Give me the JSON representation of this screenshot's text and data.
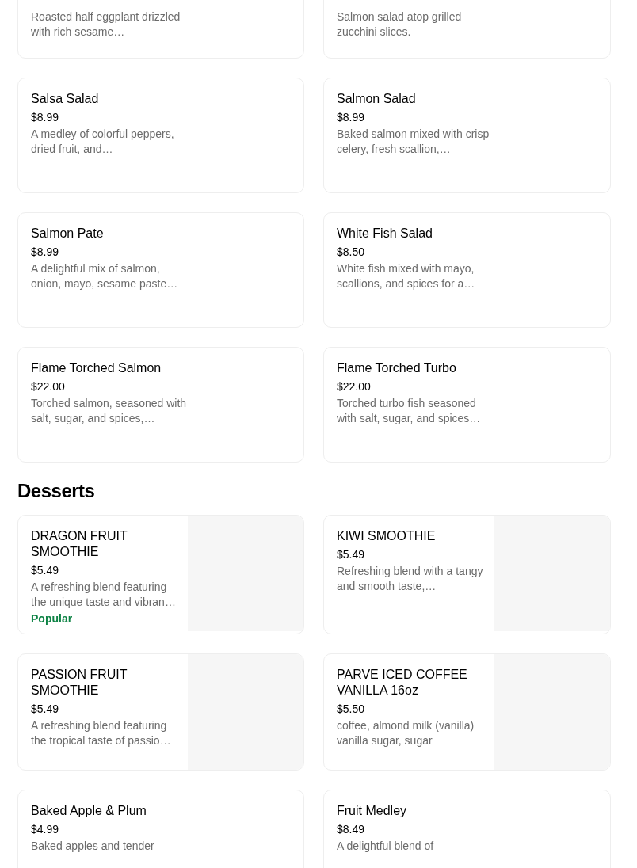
{
  "sections": [
    {
      "items": [
        {
          "description": "Roasted half eggplant drizzled with rich sesame…",
          "has_image": false
        },
        {
          "description": "Salmon salad atop grilled zucchini slices.",
          "has_image": false
        },
        {
          "name": "Salsa Salad",
          "price": "$8.99",
          "description": "A medley of colorful peppers, dried fruit, and…",
          "has_image": false
        },
        {
          "name": "Salmon Salad",
          "price": "$8.99",
          "description": "Baked salmon mixed with crisp celery, fresh scallion,…",
          "has_image": false
        },
        {
          "name": "Salmon Pate",
          "price": "$8.99",
          "description": "A delightful mix of salmon, onion, mayo, sesame paste…",
          "has_image": false
        },
        {
          "name": "White Fish Salad",
          "price": "$8.50",
          "description": "White fish mixed with mayo, scallions, and spices for a…",
          "has_image": false
        },
        {
          "name": "Flame Torched Salmon",
          "price": "$22.00",
          "description": "Torched salmon, seasoned with salt, sugar, and spices,…",
          "has_image": false
        },
        {
          "name": "Flame Torched Turbo",
          "price": "$22.00",
          "description": "Torched turbo fish seasoned with salt, sugar, and spices…",
          "has_image": false
        }
      ]
    },
    {
      "title": "Desserts",
      "items": [
        {
          "name": "DRAGON FRUIT SMOOTHIE",
          "price": "$5.49",
          "description": "A refreshing blend featuring the unique taste and vibran…",
          "badge": "Popular",
          "has_image": true
        },
        {
          "name": "KIWI SMOOTHIE",
          "price": "$5.49",
          "description": "Refreshing blend with a tangy and smooth taste,…",
          "has_image": true
        },
        {
          "name": "PASSION FRUIT SMOOTHIE",
          "price": "$5.49",
          "description": "A refreshing blend featuring the tropical taste of passio…",
          "has_image": true
        },
        {
          "name": "PARVE ICED COFFEE VANILLA 16oz",
          "price": "$5.50",
          "description": "coffee, almond milk (vanilla) vanilla sugar, sugar",
          "has_image": true
        },
        {
          "name": "Baked Apple & Plum",
          "price": "$4.99",
          "description": "Baked apples and tender",
          "has_image": false
        },
        {
          "name": "Fruit Medley",
          "price": "$8.49",
          "description": "A delightful blend of",
          "has_image": false
        }
      ]
    }
  ]
}
